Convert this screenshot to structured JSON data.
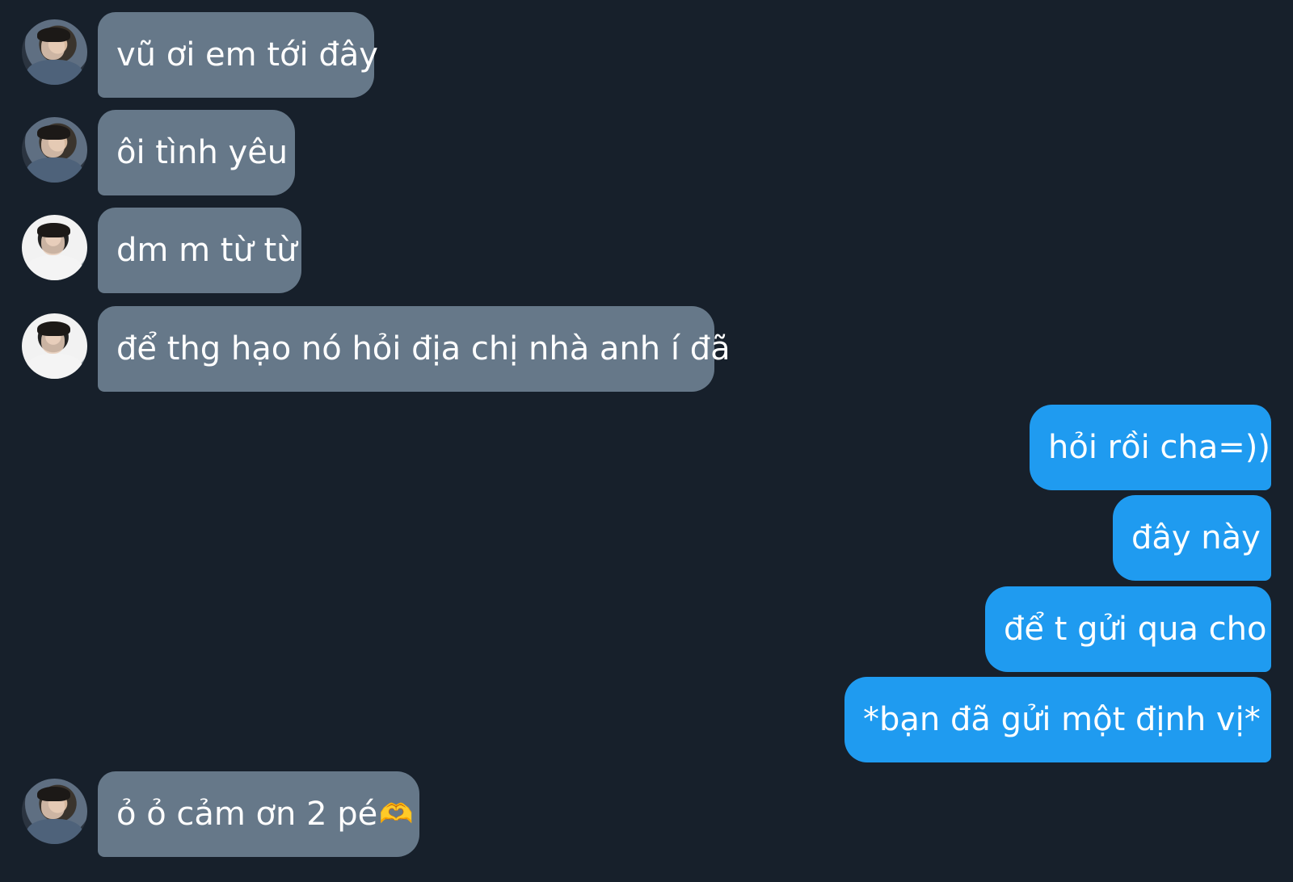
{
  "conversation": {
    "messages": [
      {
        "text": "vũ ơi em tới đây",
        "direction": "incoming",
        "avatar": "avatar-dark"
      },
      {
        "text": "ôi tình yêu",
        "direction": "incoming",
        "avatar": "avatar-dark"
      },
      {
        "text": "dm m từ từ",
        "direction": "incoming",
        "avatar": "avatar-light"
      },
      {
        "text": "để thg hạo nó hỏi địa chị nhà anh í đã",
        "direction": "incoming",
        "avatar": "avatar-light"
      },
      {
        "text": "hỏi rồi cha=))",
        "direction": "outgoing"
      },
      {
        "text": "đây này",
        "direction": "outgoing"
      },
      {
        "text": "để t gửi qua cho",
        "direction": "outgoing"
      },
      {
        "text": "*bạn đã gửi một định vị*",
        "direction": "outgoing"
      },
      {
        "text": "ỏ ỏ cảm ơn 2 pé",
        "emoji": "🫶",
        "direction": "incoming",
        "avatar": "avatar-dark"
      }
    ]
  },
  "colors": {
    "background": "#17202b",
    "incoming_bubble": "#667889",
    "outgoing_bubble": "#1f9bf0",
    "text": "#ffffff"
  }
}
